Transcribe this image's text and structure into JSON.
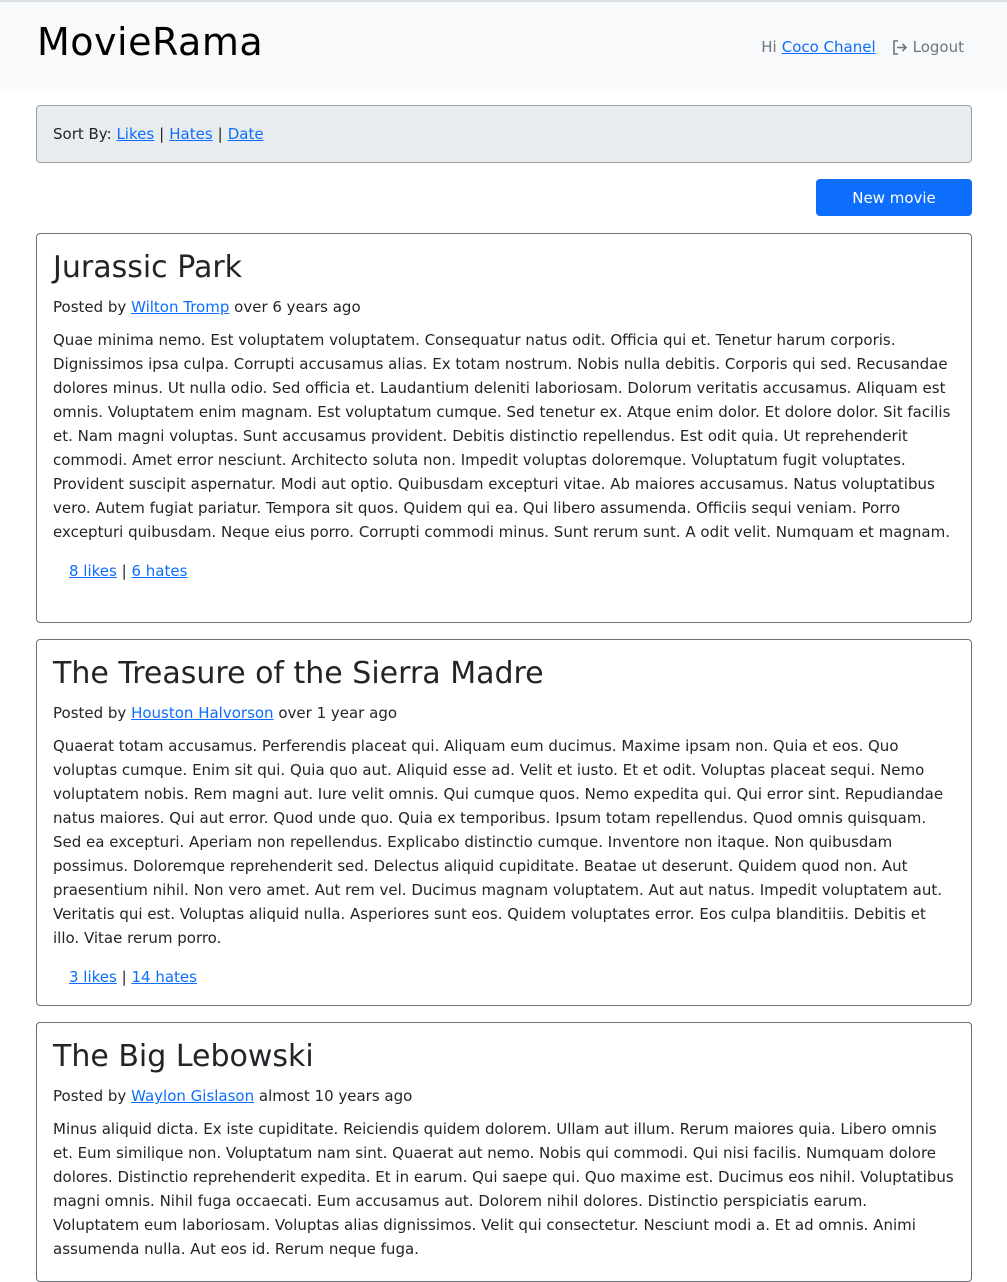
{
  "app": {
    "brand": "MovieRama"
  },
  "user": {
    "greeting": "Hi",
    "name": "Coco Chanel",
    "logout_label": "Logout"
  },
  "sort": {
    "label": "Sort By:",
    "options": [
      "Likes",
      "Hates",
      "Date"
    ],
    "separator": "|"
  },
  "actions": {
    "new_movie_label": "New movie"
  },
  "movies": [
    {
      "title": "Jurassic Park",
      "posted_prefix": "Posted by",
      "author": "Wilton Tromp",
      "age": "over 6 years ago",
      "description": "Quae minima nemo. Est voluptatem voluptatem. Consequatur natus odit. Officia qui et. Tenetur harum corporis. Dignissimos ipsa culpa. Corrupti accusamus alias. Ex totam nostrum. Nobis nulla debitis. Corporis qui sed. Recusandae dolores minus. Ut nulla odio. Sed officia et. Laudantium deleniti laboriosam. Dolorum veritatis accusamus. Aliquam est omnis. Voluptatem enim magnam. Est voluptatum cumque. Sed tenetur ex. Atque enim dolor. Et dolore dolor. Sit facilis et. Nam magni voluptas. Sunt accusamus provident. Debitis distinctio repellendus. Est odit quia. Ut reprehenderit commodi. Amet error nesciunt. Architecto soluta non. Impedit voluptas doloremque. Voluptatum fugit voluptates. Provident suscipit aspernatur. Modi aut optio. Quibusdam excepturi vitae. Ab maiores accusamus. Natus voluptatibus vero. Autem fugiat pariatur. Tempora sit quos. Quidem qui ea. Qui libero assumenda. Officiis sequi veniam. Porro excepturi quibusdam. Neque eius porro. Corrupti commodi minus. Sunt rerum sunt. A odit velit. Numquam et magnam.",
      "likes": "8 likes",
      "hates": "6 hates"
    },
    {
      "title": "The Treasure of the Sierra Madre",
      "posted_prefix": "Posted by",
      "author": "Houston Halvorson",
      "age": "over 1 year ago",
      "description": "Quaerat totam accusamus. Perferendis placeat qui. Aliquam eum ducimus. Maxime ipsam non. Quia et eos. Quo voluptas cumque. Enim sit qui. Quia quo aut. Aliquid esse ad. Velit et iusto. Et et odit. Voluptas placeat sequi. Nemo voluptatem nobis. Rem magni aut. Iure velit omnis. Qui cumque quos. Nemo expedita qui. Qui error sint. Repudiandae natus maiores. Qui aut error. Quod unde quo. Quia ex temporibus. Ipsum totam repellendus. Quod omnis quisquam. Sed ea excepturi. Aperiam non repellendus. Explicabo distinctio cumque. Inventore non itaque. Non quibusdam possimus. Doloremque reprehenderit sed. Delectus aliquid cupiditate. Beatae ut deserunt. Quidem quod non. Aut praesentium nihil. Non vero amet. Aut rem vel. Ducimus magnam voluptatem. Aut aut natus. Impedit voluptatem aut. Veritatis qui est. Voluptas aliquid nulla. Asperiores sunt eos. Quidem voluptates error. Eos culpa blanditiis. Debitis et illo. Vitae rerum porro.",
      "likes": "3 likes",
      "hates": "14 hates"
    },
    {
      "title": "The Big Lebowski",
      "posted_prefix": "Posted by",
      "author": "Waylon Gislason",
      "age": "almost 10 years ago",
      "description": "Minus aliquid dicta. Ex iste cupiditate. Reiciendis quidem dolorem. Ullam aut illum. Rerum maiores quia. Libero omnis et. Eum similique non. Voluptatum nam sint. Quaerat aut nemo. Nobis qui commodi. Qui nisi facilis. Numquam dolore dolores. Distinctio reprehenderit expedita. Et in earum. Qui saepe qui. Quo maxime est. Ducimus eos nihil. Voluptatibus magni omnis. Nihil fuga occaecati. Eum accusamus aut. Dolorem nihil dolores. Distinctio perspiciatis earum. Voluptatem eum laboriosam. Voluptas alias dignissimos. Velit qui consectetur. Nesciunt modi a. Et ad omnis. Animi assumenda nulla. Aut eos id. Rerum neque fuga.",
      "likes": "",
      "hates": ""
    }
  ]
}
